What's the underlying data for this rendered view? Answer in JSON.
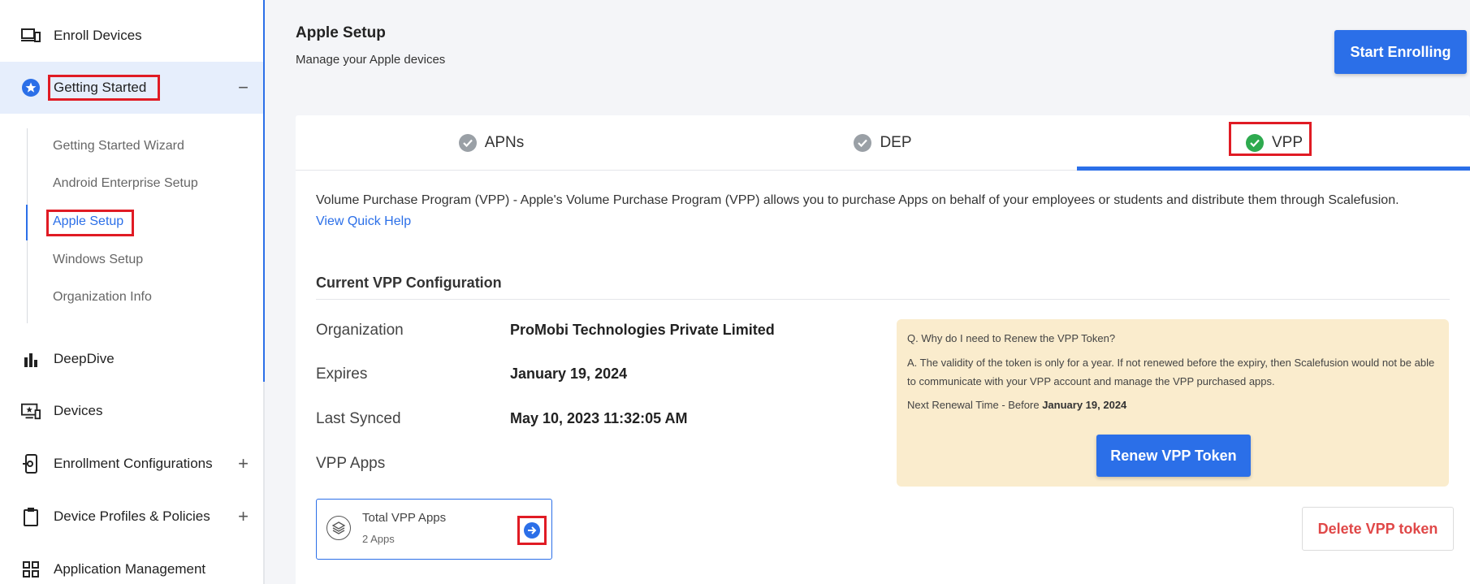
{
  "sidebar": {
    "items": [
      {
        "label": "Enroll Devices",
        "icon": "devices-icon"
      },
      {
        "label": "Getting Started",
        "icon": "star-icon",
        "toggle": "−"
      },
      {
        "label": "DeepDive",
        "icon": "bar-chart-icon"
      },
      {
        "label": "Devices",
        "icon": "monitor-icon"
      },
      {
        "label": "Enrollment Configurations",
        "icon": "phone-gear-icon",
        "toggle": "+"
      },
      {
        "label": "Device Profiles & Policies",
        "icon": "clipboard-icon",
        "toggle": "+"
      },
      {
        "label": "Application Management",
        "icon": "grid-icon"
      }
    ],
    "sub_items": [
      {
        "label": "Getting Started Wizard"
      },
      {
        "label": "Android Enterprise Setup"
      },
      {
        "label": "Apple Setup"
      },
      {
        "label": "Windows Setup"
      },
      {
        "label": "Organization Info"
      }
    ]
  },
  "header": {
    "title": "Apple Setup",
    "subtitle": "Manage your Apple devices",
    "start_button": "Start Enrolling"
  },
  "tabs": [
    {
      "label": "APNs",
      "state": "configured"
    },
    {
      "label": "DEP",
      "state": "configured"
    },
    {
      "label": "VPP",
      "state": "active"
    }
  ],
  "vpp": {
    "description": "Volume Purchase Program (VPP) - Apple's Volume Purchase Program (VPP) allows you to purchase Apps on behalf of your employees or students and distribute them through Scalefusion.",
    "quick_help": "View Quick Help",
    "section_title": "Current VPP Configuration",
    "rows": [
      {
        "label": "Organization",
        "value": "ProMobi Technologies Private Limited"
      },
      {
        "label": "Expires",
        "value": "January 19, 2024"
      },
      {
        "label": "Last Synced",
        "value": "May 10, 2023 11:32:05 AM"
      },
      {
        "label": "VPP Apps"
      }
    ],
    "apps_box": {
      "title": "Total VPP Apps",
      "count": "2 Apps"
    },
    "faq": {
      "question": "Q. Why do I need to Renew the VPP Token?",
      "answer": "A. The validity of the token is only for a year. If not renewed before the expiry, then Scalefusion would not be able to communicate with your VPP account and manage the VPP purchased apps.",
      "next_prefix": "Next Renewal Time - Before",
      "next_date": "January 19, 2024",
      "renew_button": "Renew VPP Token"
    },
    "delete_button": "Delete VPP token"
  },
  "colors": {
    "accent": "#2b6fe8",
    "success": "#2eaa4f",
    "danger": "#e04848",
    "highlight": "#e01b24",
    "faq_bg": "#faeccd"
  }
}
